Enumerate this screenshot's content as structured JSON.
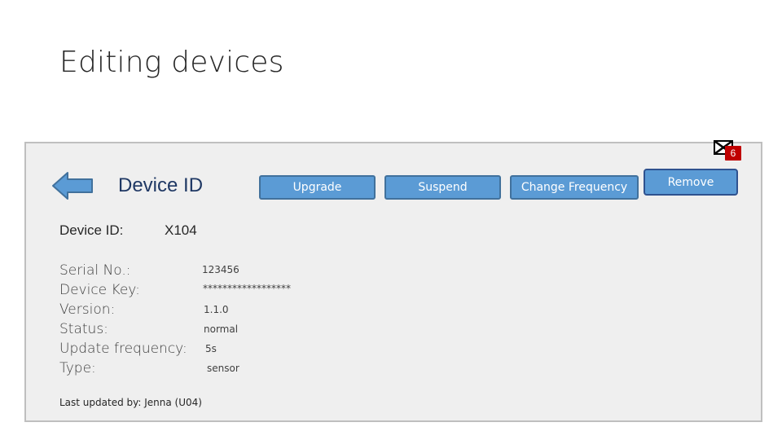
{
  "slide": {
    "title": "Editing devices"
  },
  "panel": {
    "badge": "6",
    "heading": "Device ID",
    "buttons": {
      "upgrade": "Upgrade",
      "suspend": "Suspend",
      "change_frequency": "Change Frequency",
      "remove": "Remove"
    },
    "device_id_label": "Device ID:",
    "device_id_value": "X104",
    "fields": [
      {
        "label": "Serial No.:",
        "value": "123456"
      },
      {
        "label": "Device Key:",
        "value": "******************"
      },
      {
        "label": "Version:",
        "value": "1.1.0"
      },
      {
        "label": "Status:",
        "value": "normal"
      },
      {
        "label": "Update frequency:",
        "value": "5s"
      },
      {
        "label": "Type:",
        "value": "sensor"
      }
    ],
    "last_updated": "Last updated by: Jenna (U04)"
  },
  "colors": {
    "button_fill": "#5b9bd5",
    "badge": "#c00000",
    "arrow": "#5b9bd5"
  },
  "icons": {
    "close": "close-icon",
    "back": "back-arrow-icon"
  }
}
